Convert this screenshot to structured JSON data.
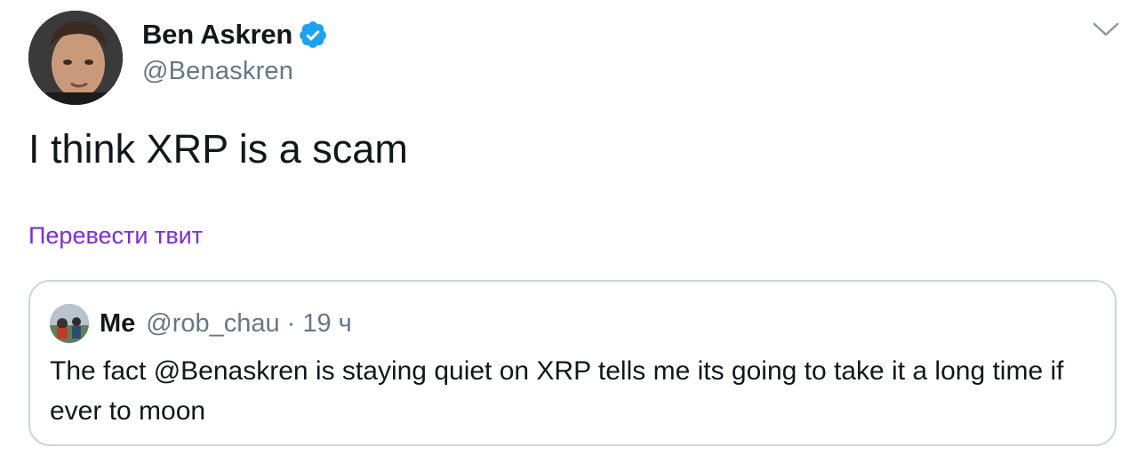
{
  "tweet": {
    "author": {
      "display_name": "Ben Askren",
      "handle": "@Benaskren",
      "verified": true,
      "avatar_icon": "user-avatar"
    },
    "text": "I think XRP is a scam",
    "translate_label": "Перевести твит",
    "menu_icon": "chevron-down-icon",
    "quoted": {
      "display_name": "Me",
      "handle": "@rob_chau",
      "separator": "·",
      "time": "19 ч",
      "text": "The fact @Benaskren is staying quiet on XRP tells me its going to take it a long time if ever to moon"
    }
  },
  "colors": {
    "verified_badge": "#1da1f2",
    "translate_link": "#7b2ddb",
    "secondary_text": "#657786",
    "border": "#ccd6dd"
  }
}
